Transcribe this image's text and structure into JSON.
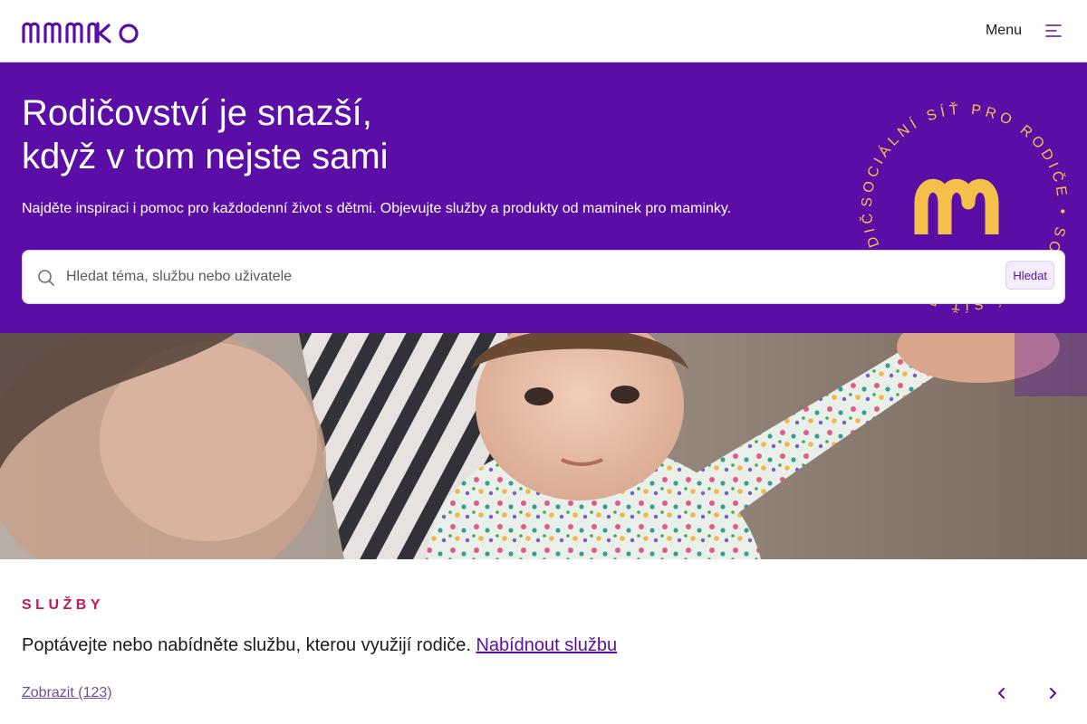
{
  "header": {
    "logo_text": "mamko",
    "menu_label": "Menu",
    "menu_icon": "hamburger-icon"
  },
  "hero": {
    "title_line1": "Rodičovství je snazší,",
    "title_line2": "když v tom nejste sami",
    "subtitle": "Najděte inspiraci i pomoc pro každodenní život s dětmi. Objevujte služby a produkty od maminek pro maminky.",
    "badge_text": "SOCIÁLNÍ SÍŤ PRO RODIČE • SOCIÁLNÍ SÍŤ PRO RODIČE •",
    "background_color": "#5b0ea6",
    "badge_color": "#f5c04a"
  },
  "search": {
    "placeholder": "Hledat téma, službu nebo uživatele",
    "value": "",
    "button_label": "Hledat",
    "icon": "search-icon"
  },
  "services": {
    "section_label": "SLUŽBY",
    "description": "Poptávejte nebo nabídněte službu, kterou využijí rodiče.",
    "offer_link": "Nabídnout službu",
    "show_all": "Zobrazit (123)",
    "prev_icon": "chevron-left-icon",
    "next_icon": "chevron-right-icon"
  },
  "colors": {
    "brand": "#5b0ea6",
    "accent": "#c2185b"
  }
}
